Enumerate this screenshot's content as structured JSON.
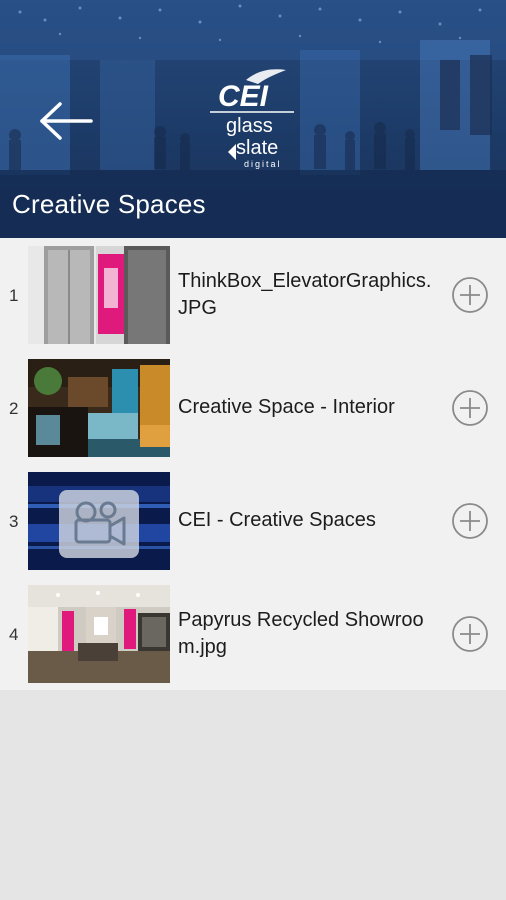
{
  "header": {
    "title": "Creative Spaces",
    "back_icon": "arrow-left-icon",
    "logo": {
      "brand": "CEI",
      "line1": "glass",
      "line2": "slate",
      "line3": "digital"
    }
  },
  "items": [
    {
      "number": "1",
      "label": "ThinkBox_ElevatorGraphics.JPG",
      "thumb": "elevator-photo",
      "icon": "add-circle-icon"
    },
    {
      "number": "2",
      "label": "Creative Space - Interior",
      "thumb": "interior-photo",
      "icon": "add-circle-icon"
    },
    {
      "number": "3",
      "label": "CEI - Creative Spaces",
      "thumb": "video-thumbnail",
      "icon": "add-circle-icon"
    },
    {
      "number": "4",
      "label": "Papyrus Recycled Showroom.jpg",
      "thumb": "showroom-photo",
      "icon": "add-circle-icon"
    }
  ],
  "colors": {
    "header_bg": "#1f3f6d",
    "title_bar": "#142c52",
    "list_bg": "#f1f1f1",
    "page_bg": "#e5e5e5"
  }
}
